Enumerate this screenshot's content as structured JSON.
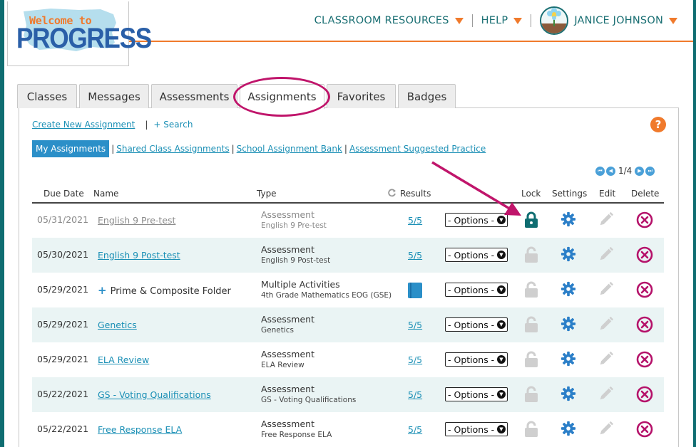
{
  "logo": {
    "welcome_text": "Welcome to",
    "brand_text": "PROGRESS"
  },
  "topnav": {
    "classroom_resources": "CLASSROOM RESOURCES",
    "help": "HELP",
    "user_name": "JANICE JOHNSON"
  },
  "tabs": [
    {
      "label": "Classes"
    },
    {
      "label": "Messages"
    },
    {
      "label": "Assessments"
    },
    {
      "label": "Assignments"
    },
    {
      "label": "Favorites"
    },
    {
      "label": "Badges"
    }
  ],
  "actions": {
    "create_new": "Create New Assignment",
    "search": "+ Search"
  },
  "filters": {
    "my_assignments": "My Assignments",
    "shared_class": "Shared Class Assignments",
    "school_bank": "School Assignment Bank",
    "suggested": "Assessment Suggested Practice"
  },
  "pager": {
    "label": "1/4"
  },
  "columns": {
    "due_date": "Due Date",
    "name": "Name",
    "type": "Type",
    "results": "Results",
    "lock": "Lock",
    "settings": "Settings",
    "edit": "Edit",
    "delete": "Delete"
  },
  "rows": [
    {
      "due": "05/31/2021",
      "name": "English 9 Pre-test",
      "type": "Assessment",
      "subtype": "English 9 Pre-test",
      "results": "5/5",
      "options": "- Options -"
    },
    {
      "due": "05/30/2021",
      "name": "English 9 Post-test",
      "type": "Assessment",
      "subtype": "English 9 Post-test",
      "results": "5/5",
      "options": "- Options -"
    },
    {
      "due": "05/29/2021",
      "name": "Prime & Composite Folder",
      "type": "Multiple Activities",
      "subtype": "4th Grade Mathematics EOG (GSE)",
      "results": "",
      "options": "- Options -"
    },
    {
      "due": "05/29/2021",
      "name": "Genetics",
      "type": "Assessment",
      "subtype": "Genetics",
      "results": "5/5",
      "options": "- Options -"
    },
    {
      "due": "05/29/2021",
      "name": "ELA Review",
      "type": "Assessment",
      "subtype": "ELA Review",
      "results": "5/5",
      "options": "- Options -"
    },
    {
      "due": "05/22/2021",
      "name": "GS - Voting Qualifications",
      "type": "Assessment",
      "subtype": "GS - Voting Qualifications",
      "results": "5/5",
      "options": "- Options -"
    },
    {
      "due": "05/22/2021",
      "name": "Free Response ELA",
      "type": "Assessment",
      "subtype": "Free Response ELA",
      "results": "5/5",
      "options": "- Options -"
    }
  ],
  "colors": {
    "teal": "#0f6d71",
    "orange": "#f07a2c",
    "link_blue": "#1a8fb5",
    "highlight_magenta": "#c0156b",
    "delete_magenta": "#b5126a",
    "gear_blue": "#2b7fc8"
  }
}
